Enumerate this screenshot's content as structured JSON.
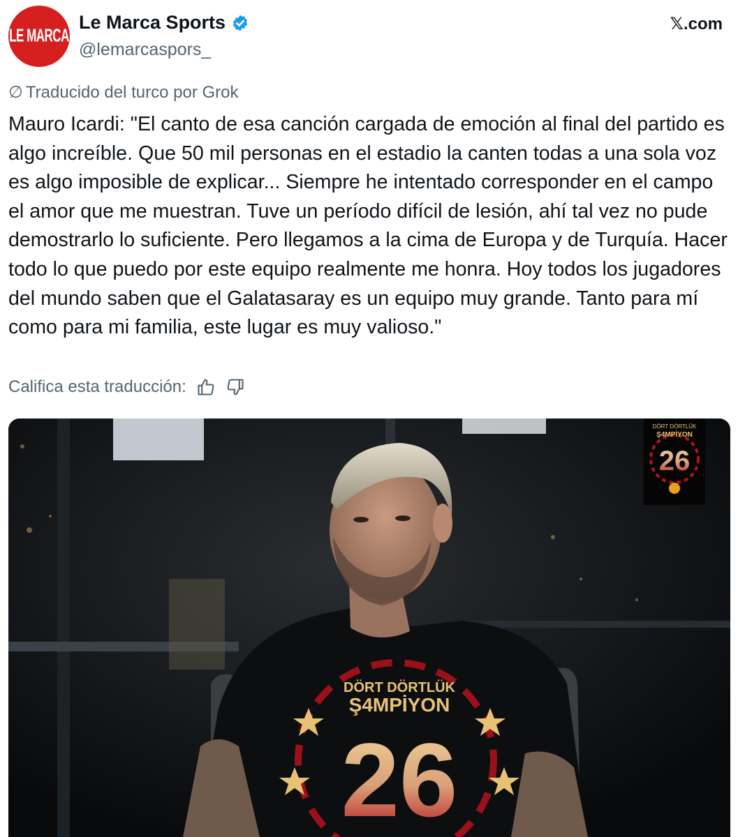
{
  "account": {
    "display_name": "Le Marca Sports",
    "handle": "@lemarcaspors_",
    "avatar_text": "LE MARCA",
    "verified": true
  },
  "site_label": "𝕏.com",
  "translation": {
    "notice": "Traducido del turco por Grok",
    "rate_label": "Califica esta traducción:"
  },
  "tweet": {
    "text": "Mauro Icardi: \"El canto de esa canción cargada de emoción al final del partido es algo increíble. Que 50 mil personas en el estadio la canten todas a una sola voz es algo imposible de explicar... Siempre he intentado corresponder en el campo el amor que me muestran. Tuve un período difícil de lesión, ahí tal vez no pude demostrarlo lo suficiente. Pero llegamos a la cima de Europa y de Turquía. Hacer todo lo que puedo por este equipo realmente me honra. Hoy todos los jugadores del mundo saben que el Galatasaray es un equipo muy grande. Tanto para mí como para mi familia, este lugar es muy valioso.\""
  },
  "media": {
    "shirt_line1": "DÖRT DÖRTLÜK",
    "shirt_line2": "Ş4MPİYON",
    "shirt_number": "26",
    "badge_line1": "DÖRT DÖRTLÜK",
    "badge_line2": "Ş4MPİYON",
    "badge_number": "26"
  },
  "colors": {
    "brand_red": "#d6201f",
    "verified_blue": "#1d9bf0",
    "secondary_text": "#536471",
    "gold": "#e8c274",
    "galatasaray_red": "#b5121b"
  }
}
